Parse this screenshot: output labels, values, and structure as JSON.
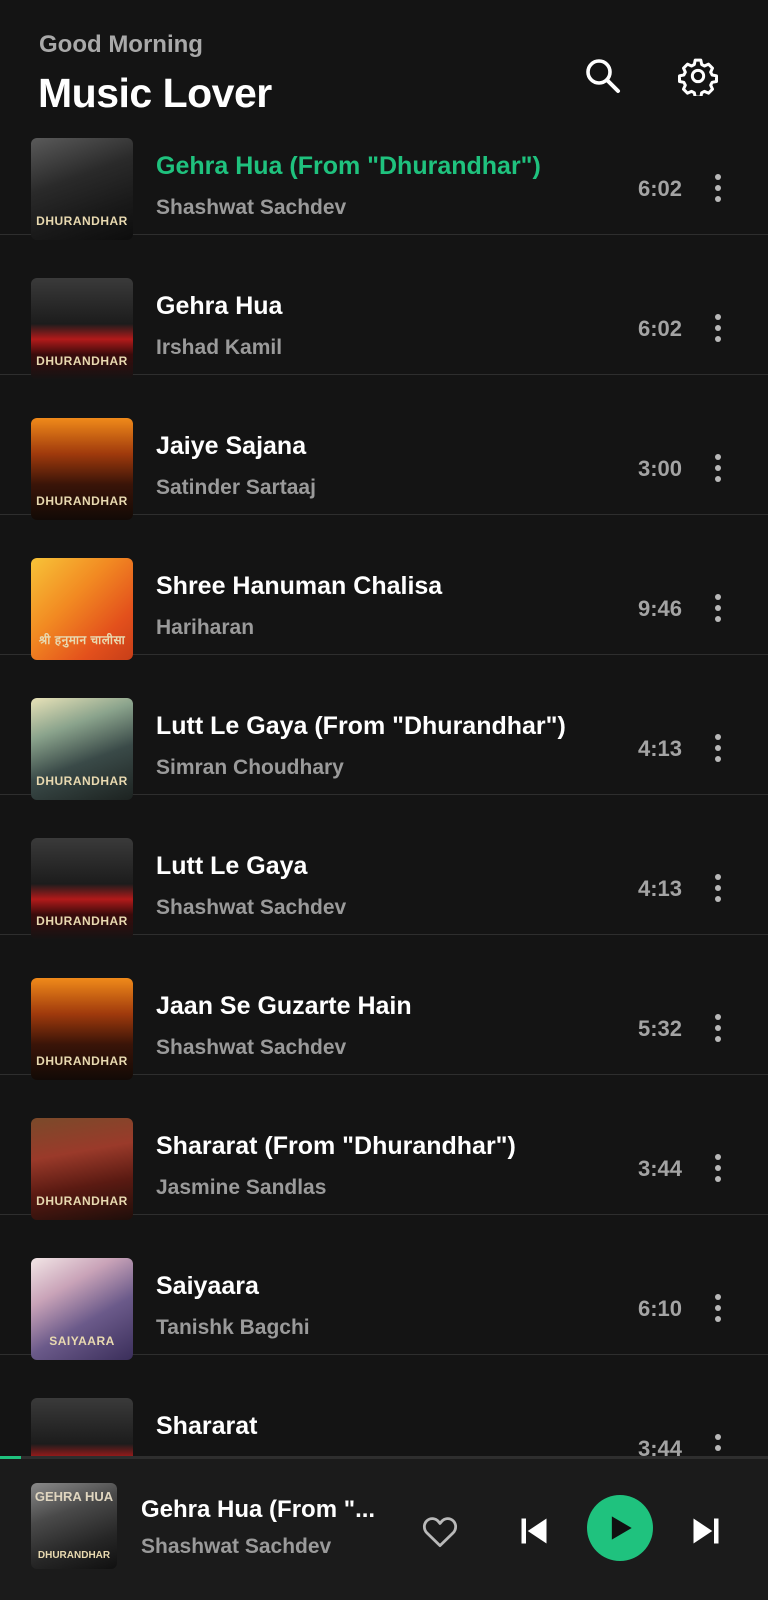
{
  "header": {
    "greeting": "Good Morning",
    "title": "Music Lover",
    "icons": [
      "search-icon",
      "gear-icon"
    ]
  },
  "songs": [
    {
      "title": "Gehra Hua (From \"Dhurandhar\")",
      "artist": "Shashwat Sachdev",
      "duration": "6:02",
      "cover_caption": "DHURANDHAR",
      "active": true
    },
    {
      "title": "Gehra Hua",
      "artist": "Irshad Kamil",
      "duration": "6:02",
      "cover_caption": "DHURANDHAR"
    },
    {
      "title": "Jaiye Sajana",
      "artist": "Satinder Sartaaj",
      "duration": "3:00",
      "cover_caption": "DHURANDHAR"
    },
    {
      "title": "Shree Hanuman Chalisa",
      "artist": "Hariharan",
      "duration": "9:46",
      "cover_caption": "श्री हनुमान चालीसा"
    },
    {
      "title": "Lutt Le Gaya (From \"Dhurandhar\")",
      "artist": "Simran Choudhary",
      "duration": "4:13",
      "cover_caption": "DHURANDHAR"
    },
    {
      "title": "Lutt Le Gaya",
      "artist": "Shashwat Sachdev",
      "duration": "4:13",
      "cover_caption": "DHURANDHAR"
    },
    {
      "title": "Jaan Se Guzarte Hain",
      "artist": "Shashwat Sachdev",
      "duration": "5:32",
      "cover_caption": "DHURANDHAR"
    },
    {
      "title": "Shararat (From \"Dhurandhar\")",
      "artist": "Jasmine Sandlas",
      "duration": "3:44",
      "cover_caption": "DHURANDHAR"
    },
    {
      "title": "Saiyaara",
      "artist": "Tanishk Bagchi",
      "duration": "6:10",
      "cover_caption": "SAIYAARA"
    },
    {
      "title": "Shararat",
      "artist": "",
      "duration": "3:44",
      "cover_caption": ""
    }
  ],
  "player": {
    "title": "Gehra Hua (From \"...",
    "artist": "Shashwat Sachdev",
    "cover_caption_top": "GEHRA HUA",
    "cover_caption_bottom": "DHURANDHAR",
    "progress": 0.027,
    "icons": [
      "heart-icon",
      "skip-previous-icon",
      "play-icon",
      "skip-next-icon"
    ]
  },
  "colors": {
    "accent": "#1fc27e",
    "background": "#141414",
    "player_bg": "#1b1b1b",
    "secondary_text": "#9a9a9a"
  }
}
